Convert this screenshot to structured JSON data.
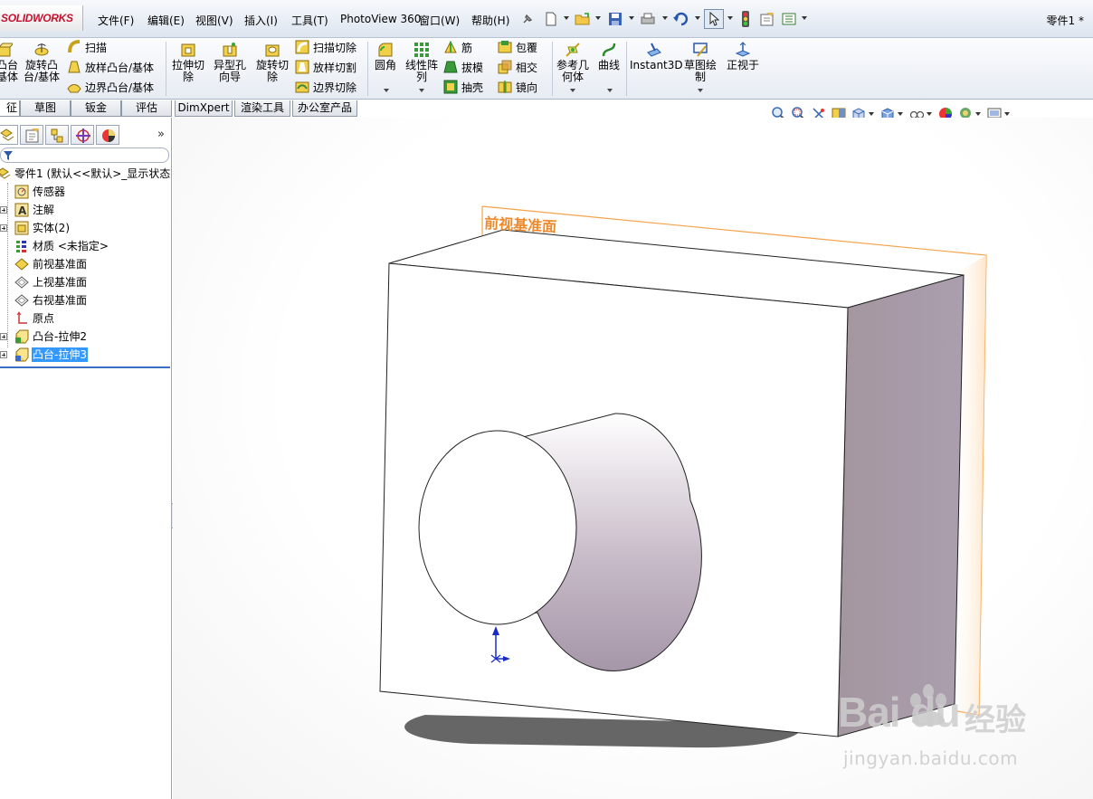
{
  "app": {
    "logo": "SOLIDWORKS",
    "document_title": "零件1 *"
  },
  "menu": [
    "文件(F)",
    "编辑(E)",
    "视图(V)",
    "插入(I)",
    "工具(T)",
    "PhotoView 360",
    "窗口(W)",
    "帮助(H)"
  ],
  "commands": {
    "extrude_boss": "凸台\n基体",
    "revolve_boss": "旋转凸\n台/基体",
    "sweep": "扫描",
    "loft_boss": "放样凸台/基体",
    "boundary_boss": "边界凸台/基体",
    "extrude_cut": "拉伸切\n除",
    "hole_wizard": "异型孔\n向导",
    "revolve_cut": "旋转切\n除",
    "swept_cut": "扫描切除",
    "lofted_cut": "放样切割",
    "boundary_cut": "边界切除",
    "fillet": "圆角",
    "linear_pattern": "线性阵\n列",
    "rib": "筋",
    "draft": "拔模",
    "shell": "抽壳",
    "wrap": "包覆",
    "intersect": "相交",
    "mirror": "镜向",
    "ref_geometry": "参考几\n何体",
    "curves": "曲线",
    "instant3d": "Instant3D",
    "sketch_drawing": "草图绘\n制",
    "normal_to": "正视于"
  },
  "tabs": [
    "征",
    "草图",
    "钣金",
    "评估",
    "DimXpert",
    "渲染工具",
    "办公室产品"
  ],
  "feature_tree": {
    "root": "零件1  (默认<<默认>_显示状态",
    "items": [
      {
        "label": "传感器",
        "icon": "sensor-icon",
        "expandable": false
      },
      {
        "label": "注解",
        "icon": "annotation-icon",
        "expandable": true
      },
      {
        "label": "实体(2)",
        "icon": "solid-bodies-icon",
        "expandable": true
      },
      {
        "label": "材质 <未指定>",
        "icon": "material-icon",
        "expandable": false
      },
      {
        "label": "前视基准面",
        "icon": "plane-icon",
        "expandable": false
      },
      {
        "label": "上视基准面",
        "icon": "plane-icon",
        "expandable": false
      },
      {
        "label": "右视基准面",
        "icon": "plane-icon",
        "expandable": false
      },
      {
        "label": "原点",
        "icon": "origin-icon",
        "expandable": false
      },
      {
        "label": "凸台-拉伸2",
        "icon": "extrude-feature-icon",
        "expandable": true
      },
      {
        "label": "凸台-拉伸3",
        "icon": "extrude-feature-icon",
        "expandable": true,
        "selected": true
      }
    ]
  },
  "viewport": {
    "plane_label": "前视基准面",
    "plane_color": "#f5a24a",
    "label_color": "#ee8a2e",
    "side_face_color": "#a99aab",
    "cylinder_color": "#b7a8ba"
  },
  "watermark": {
    "brand": "Bai du",
    "cn": "经验",
    "url": "jingyan.baidu.com"
  }
}
